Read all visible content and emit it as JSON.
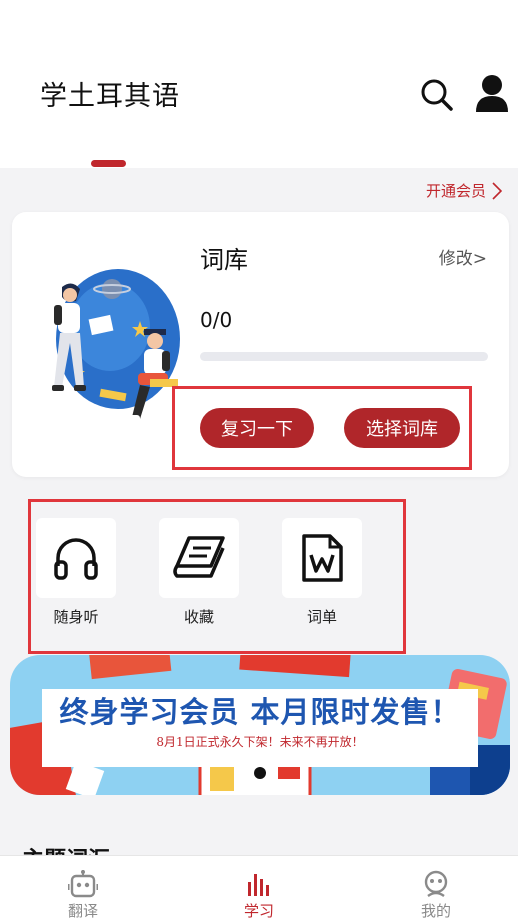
{
  "header": {
    "title": "学土耳其语",
    "search_icon": "search-icon",
    "user_icon": "user-icon"
  },
  "vip": {
    "label": "开通会员"
  },
  "vocab_card": {
    "title": "词库",
    "edit_label": "修改>",
    "progress_text": "0/0",
    "progress_fraction": 0,
    "review_button": "复习一下",
    "select_button": "选择词库"
  },
  "features": [
    {
      "label": "随身听",
      "icon": "headphones-icon"
    },
    {
      "label": "收藏",
      "icon": "book-icon"
    },
    {
      "label": "词单",
      "icon": "word-document-icon"
    }
  ],
  "banner": {
    "headline": "终身学习会员 本月限时发售！",
    "subtext": "8月1日正式永久下架！未来不再开放！"
  },
  "section": {
    "title": "主题词汇"
  },
  "nav": {
    "items": [
      {
        "label": "翻译",
        "icon": "robot-icon",
        "active": false
      },
      {
        "label": "学习",
        "icon": "bars-icon",
        "active": true
      },
      {
        "label": "我的",
        "icon": "face-icon",
        "active": false
      }
    ]
  },
  "colors": {
    "accent": "#c0272d",
    "button": "#b0262a",
    "highlight": "#e0363c",
    "banner_blue": "#1e56b0"
  }
}
